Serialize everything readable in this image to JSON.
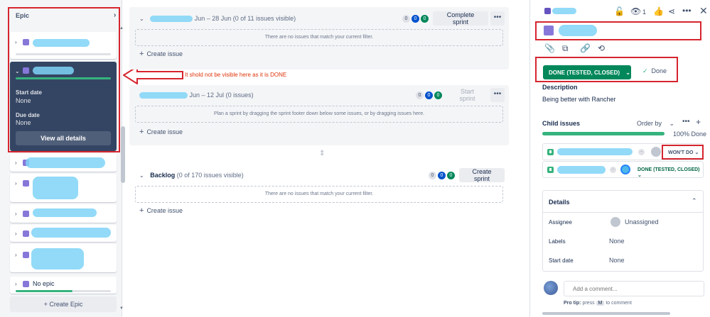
{
  "epic_panel": {
    "title": "Epic",
    "collapse_icon": "chevron-right-icon",
    "expanded_epic": {
      "start_date_label": "Start date",
      "start_date_value": "None",
      "due_date_label": "Due date",
      "due_date_value": "None",
      "view_all_label": "View all details"
    },
    "no_epic_label": "No epic",
    "create_epic_label": "+ Create Epic"
  },
  "annotation": {
    "text": "It shold not be visible here as it is DONE",
    "color": "#de350b"
  },
  "sprints": [
    {
      "dates": "Jun – 28 Jun",
      "count": "(0 of 11 issues visible)",
      "todo": "0",
      "inprogress": "0",
      "done": "0",
      "action_label": "Complete sprint",
      "empty_text": "There are no issues that match your current filter.",
      "create_label": "Create issue"
    },
    {
      "dates": "Jun – 12 Jul",
      "count": "(0 issues)",
      "todo": "0",
      "inprogress": "0",
      "done": "0",
      "action_label": "Start sprint",
      "empty_text": "Plan a sprint by dragging the sprint footer down below some issues, or by dragging issues here.",
      "create_label": "Create issue"
    }
  ],
  "backlog": {
    "title": "Backlog",
    "count": "(0 of 170 issues visible)",
    "todo": "0",
    "inprogress": "0",
    "done": "0",
    "action_label": "Create sprint",
    "empty_text": "There are no issues that match your current filter.",
    "create_label": "Create issue"
  },
  "detail": {
    "watch_count": "1",
    "status_label": "DONE (TESTED, CLOSED)",
    "resolution_label": "Done",
    "description_label": "Description",
    "description_text": "Being better with Rancher",
    "child_issues_label": "Child issues",
    "order_by_label": "Order by",
    "progress_text": "100% Done",
    "progress_fraction": 1.0,
    "children": [
      {
        "status": "WON'T DO",
        "status_color": "#42526e"
      },
      {
        "status": "DONE (TESTED, CLOSED)",
        "status_color": "#006644"
      }
    ],
    "details_label": "Details",
    "assignee_label": "Assignee",
    "assignee_value": "Unassigned",
    "labels_label": "Labels",
    "labels_value": "None",
    "start_date_label": "Start date",
    "start_date_value": "None",
    "comment_placeholder": "Add a comment...",
    "protip_bold": "Pro tip:",
    "protip_text": "press",
    "protip_key": "M",
    "protip_suffix": "to comment"
  },
  "colors": {
    "done_green": "#00875a",
    "epic_purple": "#8777d9",
    "annotation_red": "#d6252e",
    "progress_green": "#36b37e"
  }
}
